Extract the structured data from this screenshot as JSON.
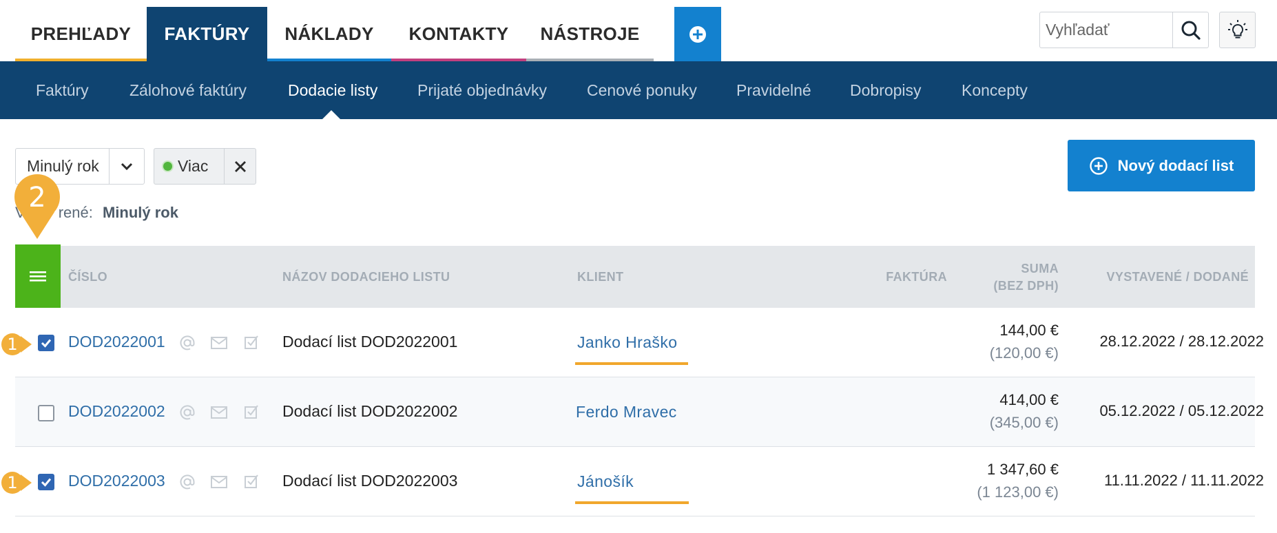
{
  "top_tabs": [
    {
      "label": "PREHĽADY",
      "accent": "#f1b02d"
    },
    {
      "label": "FAKTÚRY",
      "accent": "#0f4471"
    },
    {
      "label": "NÁKLADY",
      "accent": "#1381cf"
    },
    {
      "label": "KONTAKTY",
      "accent": "#c2407f"
    },
    {
      "label": "NÁSTROJE",
      "accent": "#a9afb5"
    }
  ],
  "active_top_tab": "FAKTÚRY",
  "search": {
    "placeholder": "Vyhľadať"
  },
  "sub_tabs": [
    {
      "label": "Faktúry"
    },
    {
      "label": "Zálohové faktúry"
    },
    {
      "label": "Dodacie listy"
    },
    {
      "label": "Prijaté objednávky"
    },
    {
      "label": "Cenové ponuky"
    },
    {
      "label": "Pravidelné"
    },
    {
      "label": "Dobropisy"
    },
    {
      "label": "Koncepty"
    }
  ],
  "active_sub_tab": "Dodacie listy",
  "filters": {
    "period": "Minulý rok",
    "more": "Viac"
  },
  "new_button": {
    "label": "Nový dodací list"
  },
  "selected": {
    "prefix": "V",
    "prefix_tail": "rené:",
    "value": "Minulý rok"
  },
  "table": {
    "columns": {
      "number": "ČÍSLO",
      "name": "NÁZOV DODACIEHO LISTU",
      "client": "KLIENT",
      "invoice": "FAKTÚRA",
      "sum_line1": "SUMA",
      "sum_line2": "(BEZ DPH)",
      "dates": "VYSTAVENÉ / DODANÉ"
    },
    "rows": [
      {
        "number": "DOD2022001",
        "name": "Dodací list DOD2022001",
        "client": "Janko Hraško",
        "amount": "144,00 €",
        "amount_net": "(120,00 €)",
        "dates": "28.12.2022 / 28.12.2022",
        "checked": true
      },
      {
        "number": "DOD2022002",
        "name": "Dodací list DOD2022002",
        "client": "Ferdo Mravec",
        "amount": "414,00 €",
        "amount_net": "(345,00 €)",
        "dates": "05.12.2022 / 05.12.2022",
        "checked": false
      },
      {
        "number": "DOD2022003",
        "name": "Dodací list DOD2022003",
        "client": "Jánošík",
        "amount": "1 347,60 €",
        "amount_net": "(1 123,00 €)",
        "dates": "11.11.2022 / 11.11.2022",
        "checked": true
      }
    ]
  },
  "callouts": {
    "checkbox_marker": "1",
    "menu_marker": "2"
  },
  "colors": {
    "brand_dark": "#0f4471",
    "brand_blue": "#1381cf",
    "menu_green": "#4cb31a",
    "callout": "#f2af3a"
  }
}
